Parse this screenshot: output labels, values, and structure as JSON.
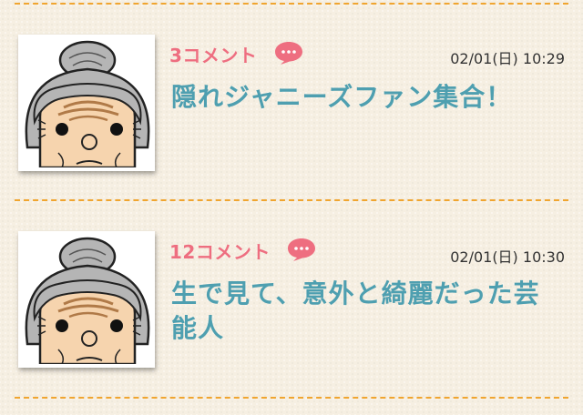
{
  "posts": [
    {
      "comments_label": "3コメント",
      "timestamp": "02/01(日) 10:29",
      "title": "隠れジャニーズファン集合！",
      "comment_icon": "speech-bubble-icon",
      "avatar": "old-woman-avatar"
    },
    {
      "comments_label": "12コメント",
      "timestamp": "02/01(日) 10:30",
      "title": "生で見て、意外と綺麗だった芸能人",
      "comment_icon": "speech-bubble-icon",
      "avatar": "old-woman-avatar"
    }
  ],
  "colors": {
    "background": "#f6efe2",
    "divider": "#f0a530",
    "comment_count": "#ee6e80",
    "title": "#4e9fb0",
    "timestamp": "#333333"
  }
}
